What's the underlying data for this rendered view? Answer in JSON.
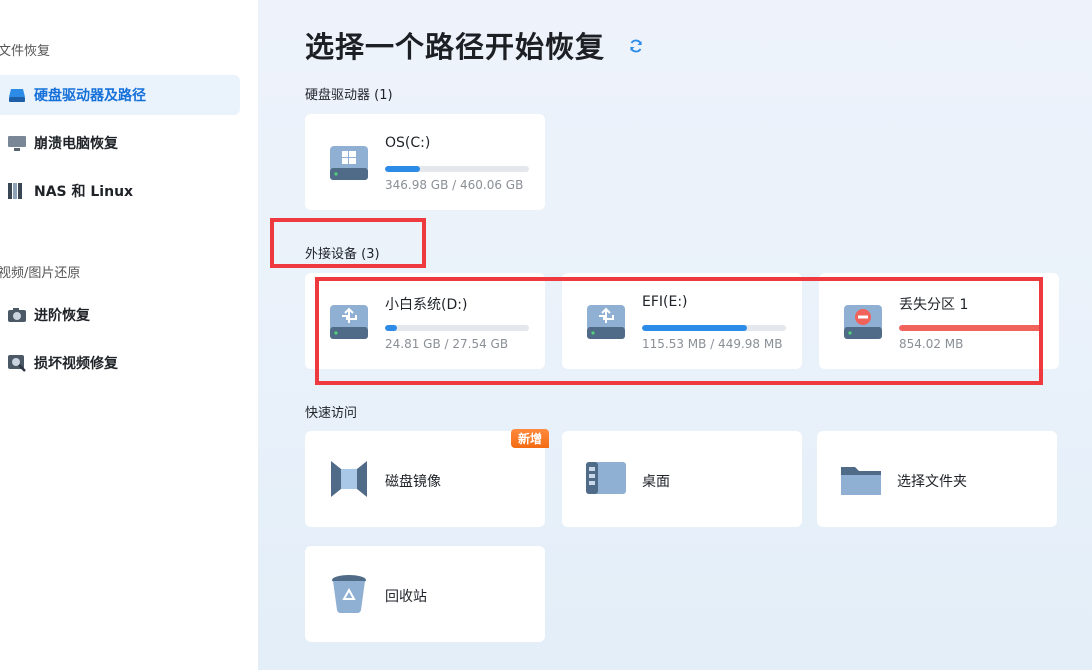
{
  "sidebar": {
    "section_file_recovery": "文件恢复",
    "section_video_photo": "视频/图片还原",
    "items": [
      {
        "label": "硬盘驱动器及路径"
      },
      {
        "label": "崩溃电脑恢复"
      },
      {
        "label": "NAS 和 Linux"
      },
      {
        "label": "进阶恢复"
      },
      {
        "label": "损坏视频修复"
      }
    ]
  },
  "main": {
    "title": "选择一个路径开始恢复",
    "hard_drives_label": "硬盘驱动器 (1)",
    "external_label": "外接设备 (3)",
    "quick_access_label": "快速访问",
    "drives": [
      {
        "name": "OS(C:)",
        "size": "346.98 GB / 460.06 GB",
        "fill": 0.24,
        "color": "#2b8be6"
      }
    ],
    "external_devices": [
      {
        "name": "小白系统(D:)",
        "size": "24.81 GB / 27.54 GB",
        "fill": 0.08,
        "color": "#2b8be6"
      },
      {
        "name": "EFI(E:)",
        "size": "115.53 MB / 449.98 MB",
        "fill": 0.73,
        "color": "#2b8be6"
      },
      {
        "name": "丢失分区 1",
        "size": "854.02 MB",
        "fill": 1.0,
        "color": "#f0625a"
      }
    ],
    "quick_access": [
      {
        "label": "磁盘镜像",
        "badge": "新增"
      },
      {
        "label": "桌面"
      },
      {
        "label": "选择文件夹"
      },
      {
        "label": "回收站"
      }
    ]
  }
}
